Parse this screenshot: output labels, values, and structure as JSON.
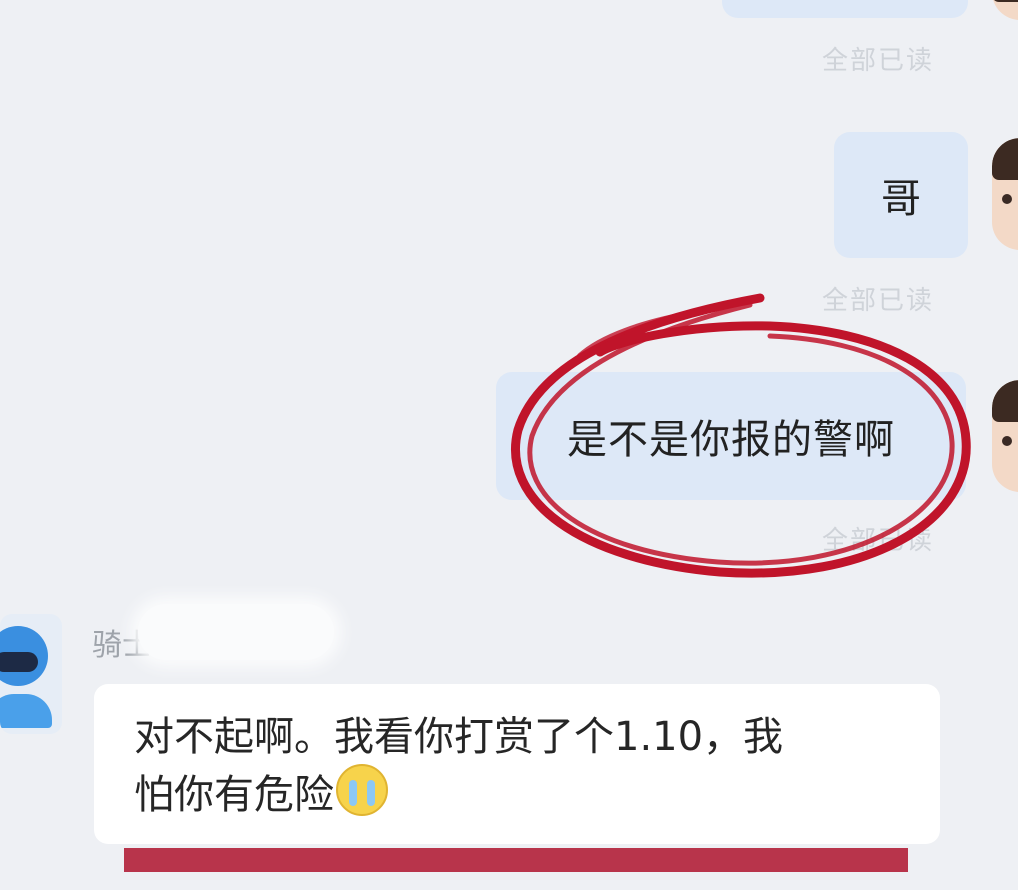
{
  "messages_out": [
    {
      "text": "",
      "read_status": "全部已读"
    },
    {
      "text": "哥",
      "read_status": "全部已读"
    },
    {
      "text": "是不是你报的警啊",
      "read_status": "全部已读"
    }
  ],
  "incoming": {
    "sender_name": "骑士",
    "message_line1": "对不起啊。我看你打赏了个1.10，我",
    "message_line2": "怕你有危险",
    "emoji": "crying-face"
  },
  "colors": {
    "background": "#eef0f4",
    "bubble_out": "#dde8f7",
    "bubble_in": "#ffffff",
    "annotation_red": "#c0142a",
    "bar_red": "#b8344b"
  }
}
